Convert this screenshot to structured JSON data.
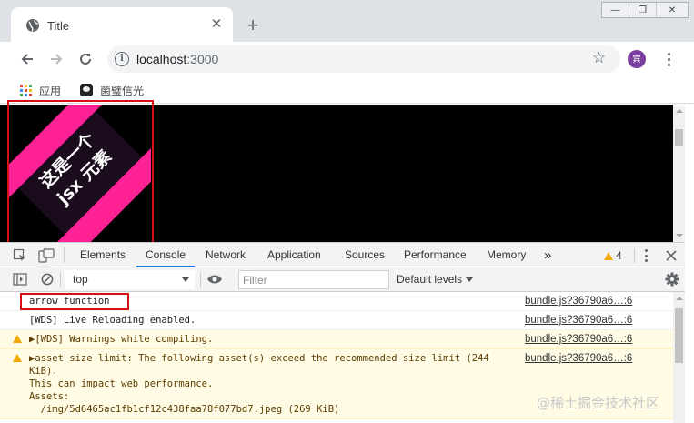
{
  "browser": {
    "tab_title": "Title",
    "tab_close": "✕",
    "new_tab": "+",
    "window_buttons": [
      "—",
      "❐",
      "✕"
    ],
    "url_host": "localhost",
    "url_port": ":3000",
    "avatar_text": "宾",
    "bookmarks": [
      "应用",
      "菌璧信光"
    ]
  },
  "page": {
    "art_lines": [
      "这是一个",
      "jsx 元素"
    ],
    "art_colors": {
      "stripe": "#ff2196",
      "bg": "#1b0c1d",
      "text": "#ffffff"
    }
  },
  "devtools": {
    "tabs": [
      "Elements",
      "Console",
      "Network",
      "Application",
      "Sources",
      "Performance",
      "Memory"
    ],
    "active_tab": "Console",
    "more_tabs": "»",
    "warning_count": "4",
    "context": "top",
    "filter_placeholder": "Filter",
    "levels": "Default levels",
    "messages": [
      {
        "text": "arrow function",
        "source": "bundle.js?36790a6…:6",
        "level": "log"
      },
      {
        "text": "[WDS] Live Reloading enabled.",
        "source": "bundle.js?36790a6…:6",
        "level": "log"
      },
      {
        "text": "▶[WDS] Warnings while compiling.",
        "source": "bundle.js?36790a6…:6",
        "level": "warning"
      },
      {
        "text": "▶asset size limit: The following asset(s) exceed the recommended size limit (244\nKiB).\nThis can impact web performance.\nAssets:\n  /img/5d6465ac1fb1cf12c438faa78f077bd7.jpeg (269 KiB)",
        "source": "bundle.js?36790a6…:6",
        "level": "warning"
      }
    ]
  },
  "watermark": "@稀土掘金技术社区",
  "colors": {
    "highlight": "#d51111",
    "devtools_accent": "#1a73e8",
    "warning": "#f2a600"
  }
}
